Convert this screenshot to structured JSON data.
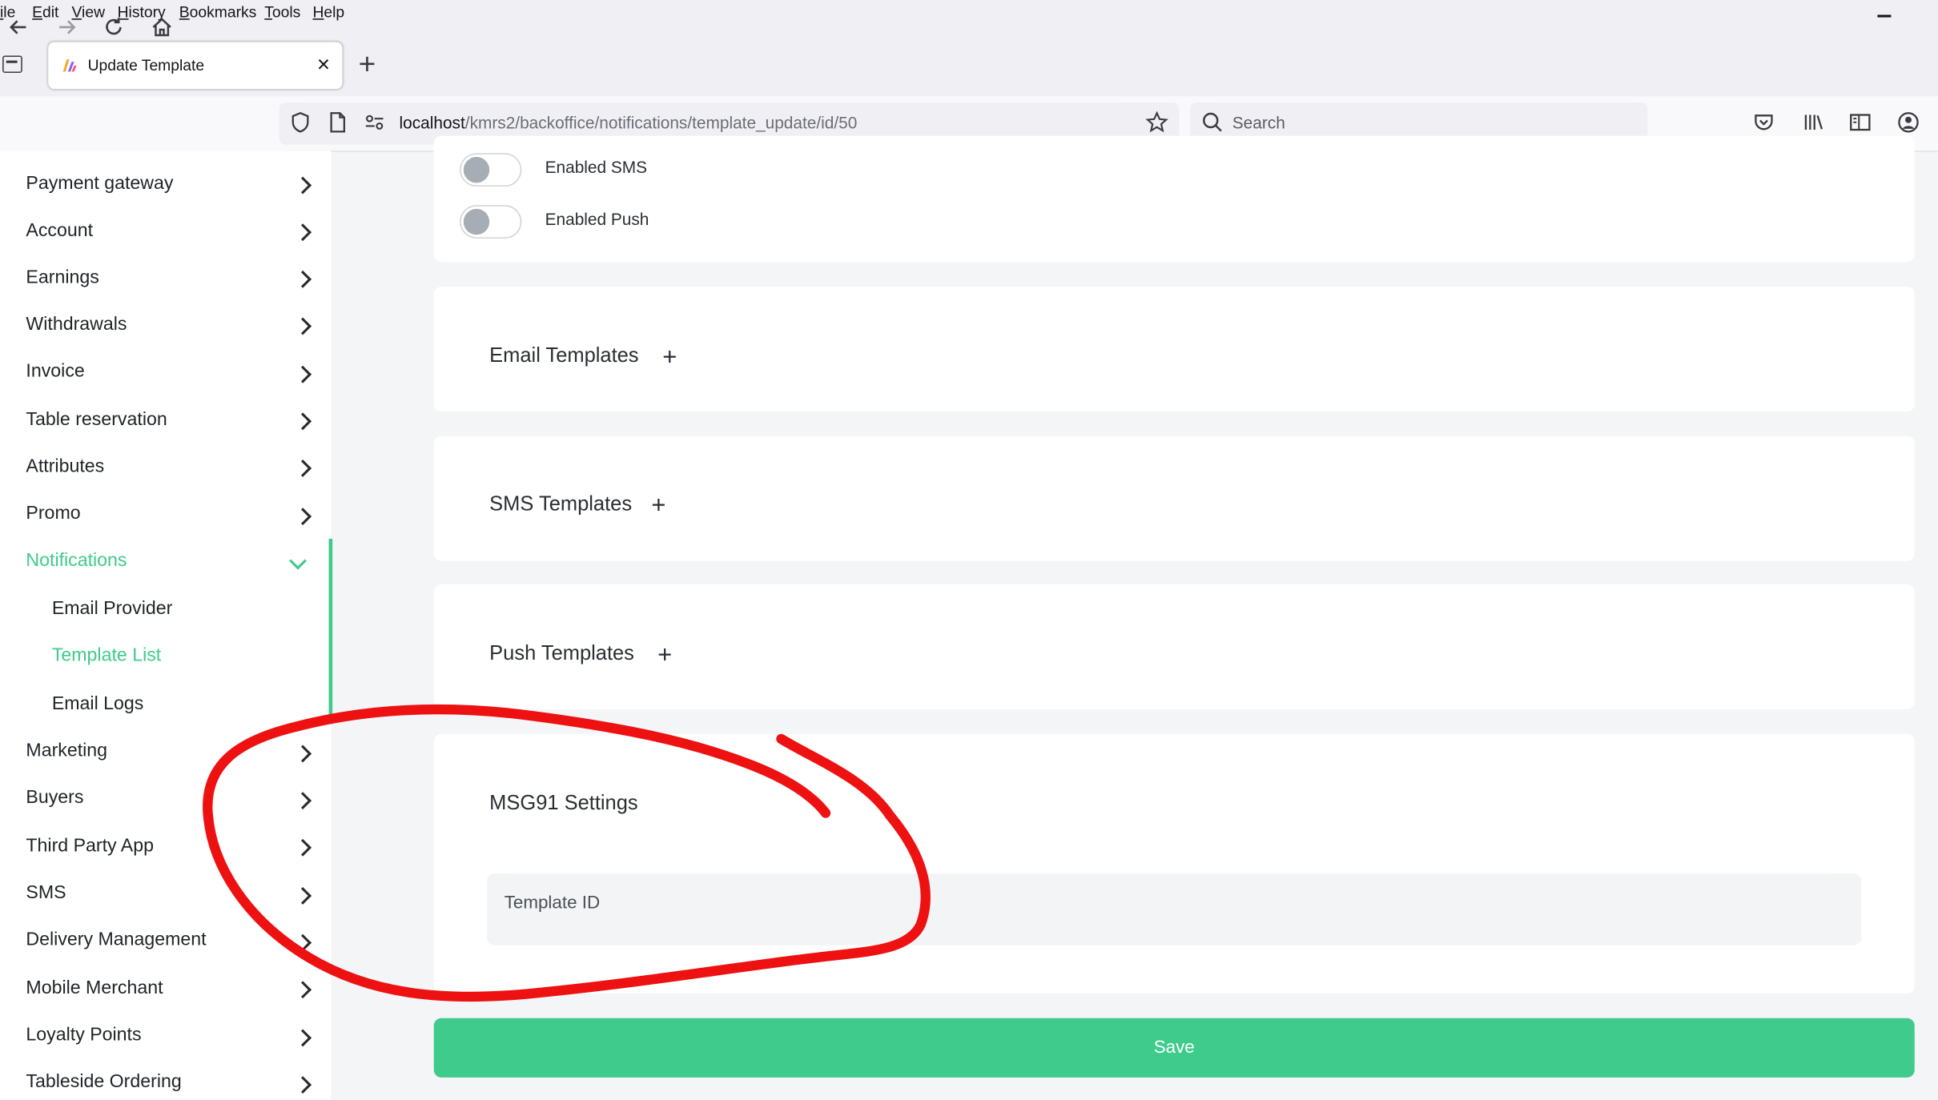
{
  "browser": {
    "menu": [
      "ile",
      "Edit",
      "View",
      "History",
      "Bookmarks",
      "Tools",
      "Help"
    ],
    "tab_title": "Update Template",
    "url_host": "localhost",
    "url_path": "/kmrs2/backoffice/notifications/template_update/id/50",
    "search_placeholder": "Search"
  },
  "sidebar": {
    "items": [
      {
        "label": "Payment gateway"
      },
      {
        "label": "Account"
      },
      {
        "label": "Earnings"
      },
      {
        "label": "Withdrawals"
      },
      {
        "label": "Invoice"
      },
      {
        "label": "Table reservation"
      },
      {
        "label": "Attributes"
      },
      {
        "label": "Promo"
      },
      {
        "label": "Notifications",
        "expanded": true
      },
      {
        "label": "Marketing"
      },
      {
        "label": "Buyers"
      },
      {
        "label": "Third Party App"
      },
      {
        "label": "SMS"
      },
      {
        "label": "Delivery Management"
      },
      {
        "label": "Mobile Merchant"
      },
      {
        "label": "Loyalty Points"
      },
      {
        "label": "Tableside Ordering"
      }
    ],
    "sub_items": [
      {
        "label": "Email Provider"
      },
      {
        "label": "Template List",
        "active": true
      },
      {
        "label": "Email Logs"
      }
    ]
  },
  "main": {
    "toggles": [
      {
        "label": "Enabled SMS",
        "on": false
      },
      {
        "label": "Enabled Push",
        "on": false
      }
    ],
    "sections": [
      {
        "title": "Email Templates"
      },
      {
        "title": "SMS Templates"
      },
      {
        "title": "Push Templates"
      }
    ],
    "msg91": {
      "title": "MSG91 Settings",
      "template_id_label": "Template ID"
    },
    "save_label": "Save"
  },
  "colors": {
    "accent": "#3ecb8c",
    "annotation": "#ee1111"
  }
}
